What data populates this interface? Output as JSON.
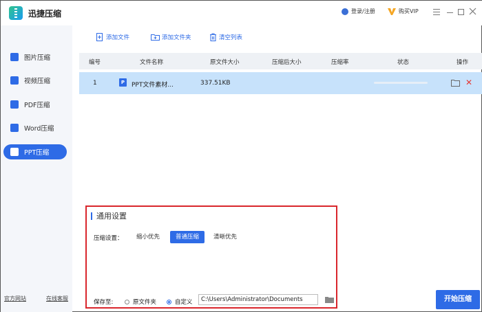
{
  "app": {
    "title": "迅捷压缩"
  },
  "header": {
    "login": "登录/注册",
    "vip": "购买VIP"
  },
  "sidebar": {
    "items": [
      {
        "label": "图片压缩",
        "icon": "image-icon"
      },
      {
        "label": "视频压缩",
        "icon": "video-icon"
      },
      {
        "label": "PDF压缩",
        "icon": "pdf-icon"
      },
      {
        "label": "Word压缩",
        "icon": "word-icon"
      },
      {
        "label": "PPT压缩",
        "icon": "ppt-icon",
        "active": true
      }
    ],
    "footer": {
      "website": "官方网站",
      "support": "在线客服"
    }
  },
  "toolbar": {
    "add_file": "添加文件",
    "add_folder": "添加文件夹",
    "clear_list": "清空列表"
  },
  "table": {
    "headers": {
      "index": "编号",
      "name": "文件名称",
      "orig_size": "原文件大小",
      "comp_size": "压缩后大小",
      "ratio": "压缩率",
      "status": "状态",
      "actions": "操作"
    },
    "rows": [
      {
        "index": "1",
        "badge": "P",
        "name": "PPT文件素材...",
        "orig_size": "337.51KB",
        "comp_size": "",
        "ratio": "",
        "progress": 0
      }
    ]
  },
  "settings": {
    "title": "通用设置",
    "compress_label": "压缩设置：",
    "options": [
      "缩小优先",
      "普通压缩",
      "清晰优先"
    ],
    "selected_option": "普通压缩",
    "save_label": "保存至:",
    "save_opts": [
      "原文件夹",
      "自定义"
    ],
    "save_selected": "自定义",
    "save_path": "C:\\Users\\Administrator\\Documents"
  },
  "start_button": "开始压缩",
  "colors": {
    "accent": "#2e6be6",
    "highlight_row": "#c7e2fb",
    "danger": "#d9252b"
  }
}
